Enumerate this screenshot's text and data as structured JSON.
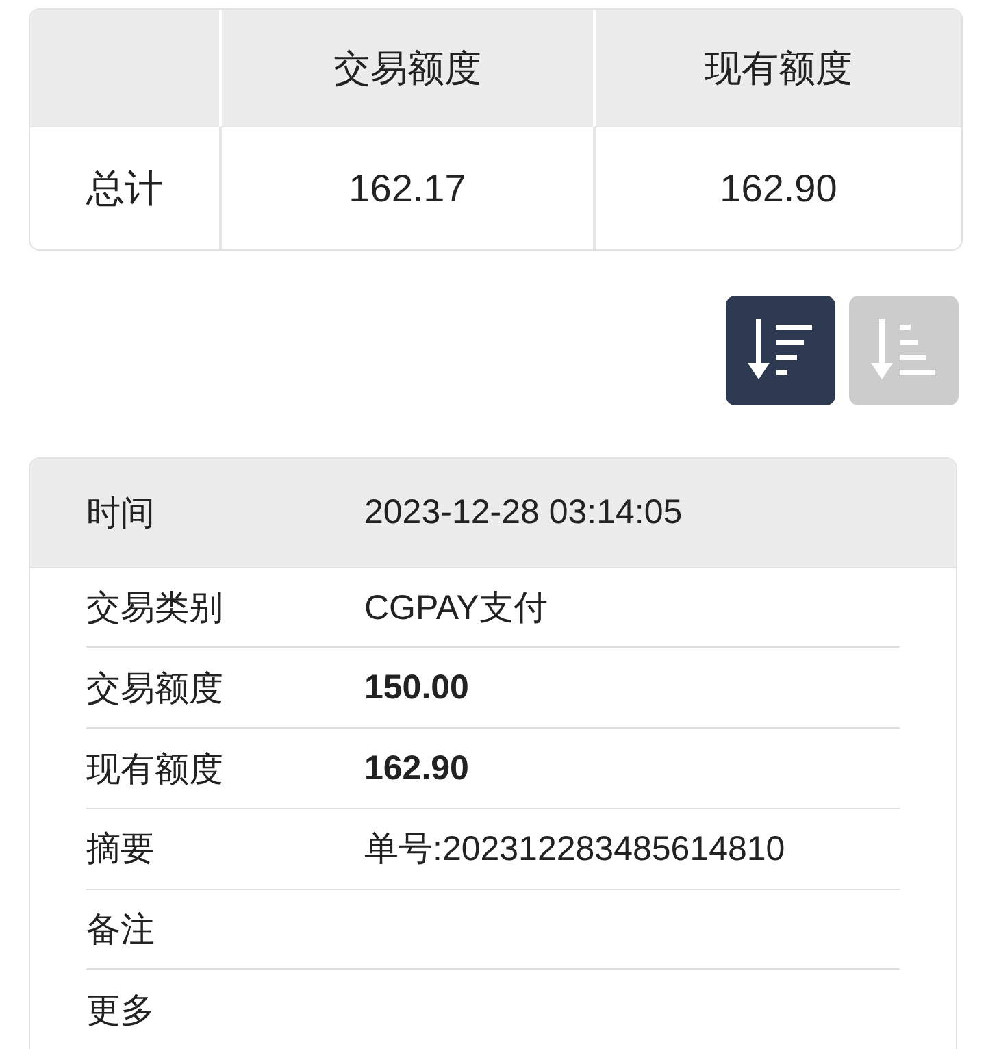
{
  "summary_table": {
    "columns": [
      "交易额度",
      "现有额度"
    ],
    "rows": [
      {
        "label": "总计",
        "cells": [
          "162.17",
          "162.90"
        ]
      }
    ]
  },
  "sort_buttons": [
    {
      "kind": "descending",
      "selected": true
    },
    {
      "kind": "ascending",
      "selected": false
    }
  ],
  "detail": {
    "header": {
      "label": "时间",
      "value": "2023-12-28 03:14:05"
    },
    "rows": [
      {
        "label": "交易类别",
        "value": "CGPAY支付",
        "bold": false
      },
      {
        "label": "交易额度",
        "value": "150.00",
        "bold": true
      },
      {
        "label": "现有额度",
        "value": "162.90",
        "bold": true
      },
      {
        "label": "摘要",
        "value": "单号:202312283485614810",
        "bold": false
      },
      {
        "label": "备注"
      },
      {
        "label": "更多"
      }
    ]
  }
}
